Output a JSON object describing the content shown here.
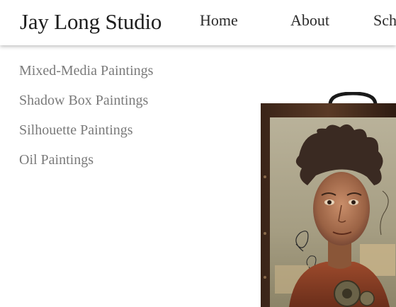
{
  "header": {
    "site_title": "Jay Long  Studio",
    "nav": [
      {
        "label": "Home"
      },
      {
        "label": "About"
      },
      {
        "label": "Sch"
      }
    ]
  },
  "sidebar": {
    "items": [
      {
        "label": "Mixed-Media Paintings"
      },
      {
        "label": "Shadow Box Paintings"
      },
      {
        "label": "Silhouette Paintings"
      },
      {
        "label": "Oil Paintings"
      }
    ]
  },
  "colors": {
    "title": "#1e1e1e",
    "nav_text": "#2a2a2a",
    "sidebar_text": "#7a7a7a",
    "background": "#ffffff"
  }
}
